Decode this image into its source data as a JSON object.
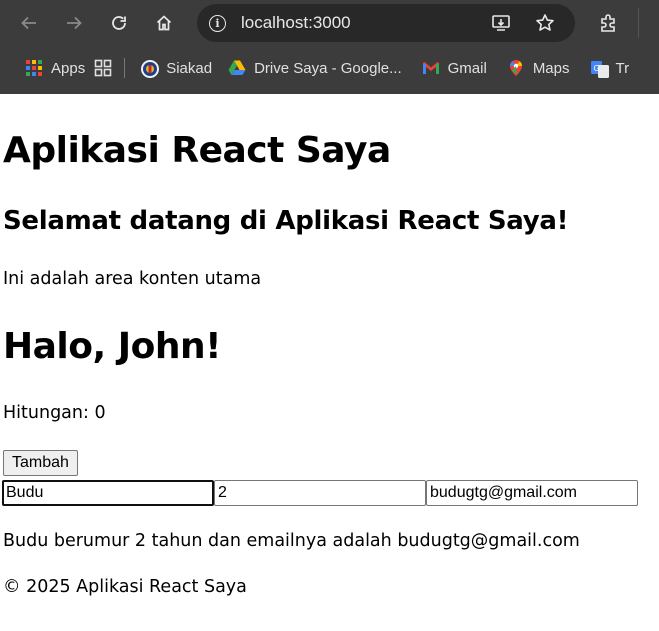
{
  "browser": {
    "url": "localhost:3000",
    "bookmarks": {
      "apps": "Apps",
      "siakad": "Siakad",
      "drive": "Drive Saya - Google...",
      "gmail": "Gmail",
      "maps": "Maps",
      "translate": "Tr"
    }
  },
  "app": {
    "title": "Aplikasi React Saya",
    "welcome": "Selamat datang di Aplikasi React Saya!",
    "content": "Ini adalah area konten utama",
    "greeting": "Halo, John!",
    "counter_text": "Hitungan: 0",
    "add_button": "Tambah",
    "form": {
      "name": "Budu",
      "age": "2",
      "email": "budugtg@gmail.com"
    },
    "summary": "Budu berumur 2 tahun dan emailnya adalah budugtg@gmail.com",
    "footer": "© 2025 Aplikasi React Saya"
  }
}
